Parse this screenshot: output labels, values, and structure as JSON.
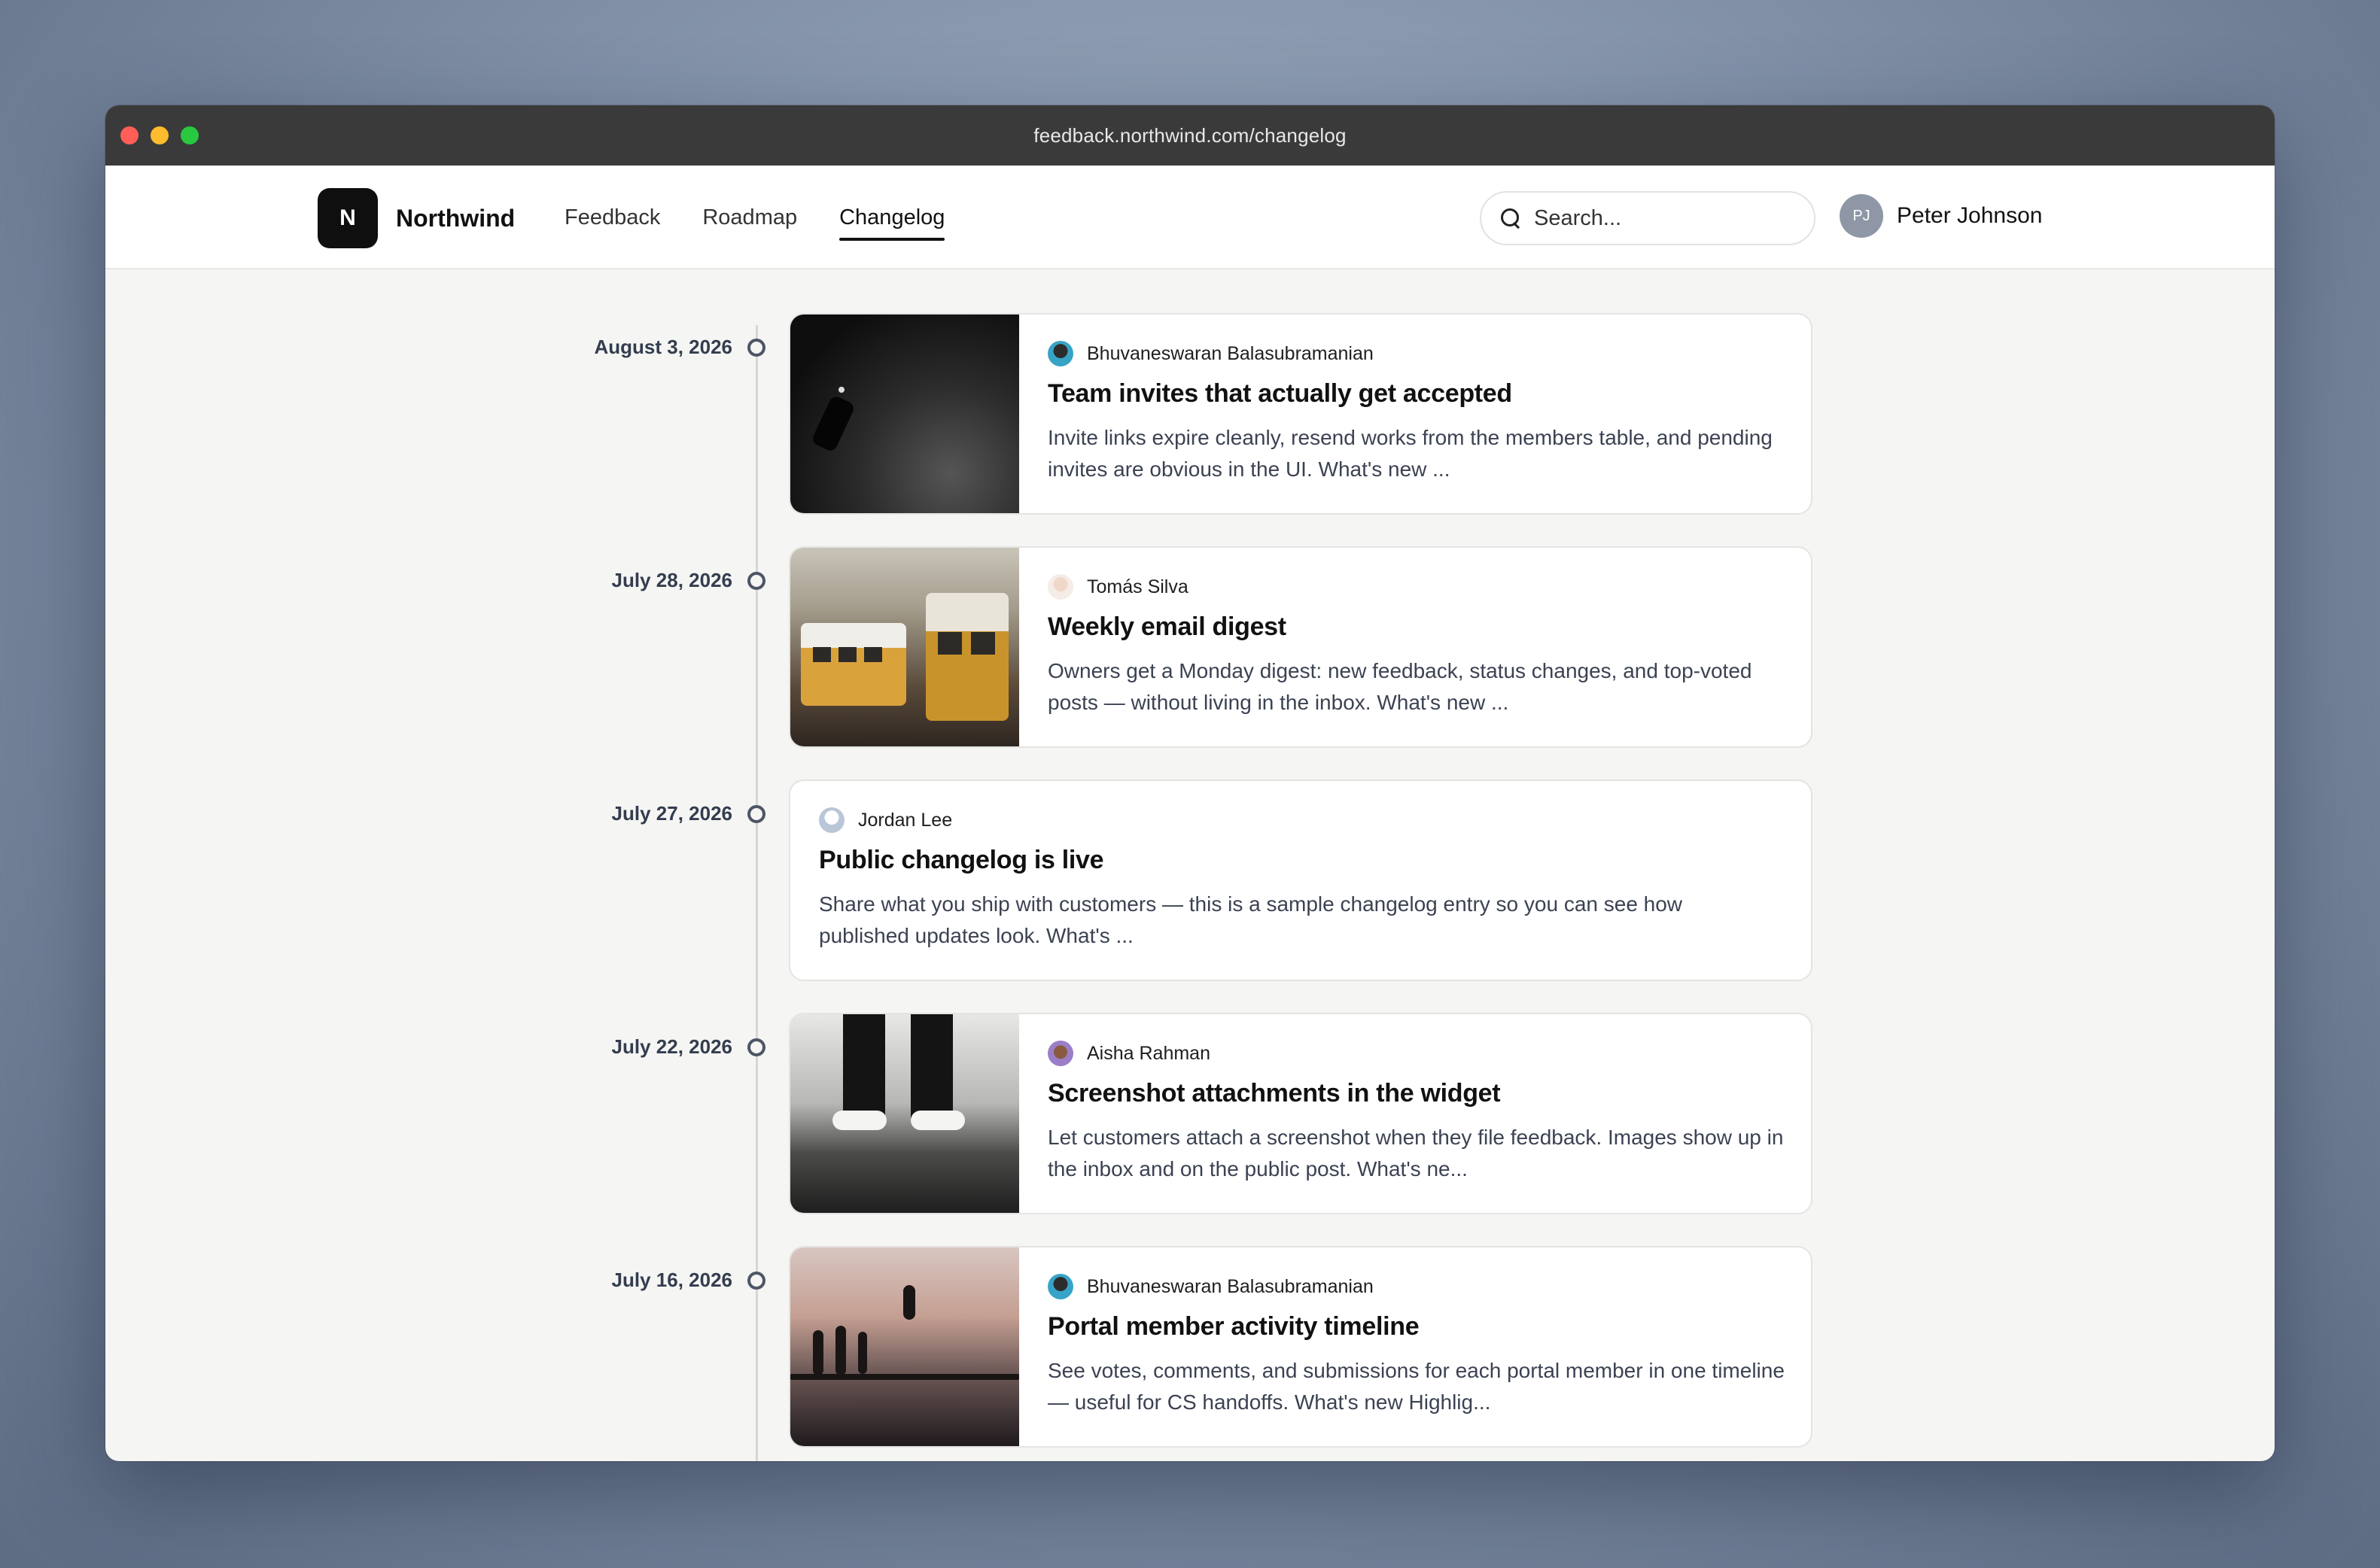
{
  "browser": {
    "url": "feedback.northwind.com/changelog"
  },
  "brand": {
    "logo_letter": "N",
    "name": "Northwind"
  },
  "nav": {
    "items": [
      {
        "label": "Feedback"
      },
      {
        "label": "Roadmap"
      },
      {
        "label": "Changelog",
        "active": true
      }
    ]
  },
  "search": {
    "placeholder": "Search..."
  },
  "user": {
    "initials": "PJ",
    "name": "Peter Johnson"
  },
  "entries": [
    {
      "date": "August 3, 2026",
      "author": "Bhuvaneswaran Balasubramanian",
      "title": "Team invites that actually get accepted",
      "excerpt": "Invite links expire cleanly, resend works from the members table, and pending invites are obvious in the UI. What's new ...",
      "has_image": true
    },
    {
      "date": "July 28, 2026",
      "author": "Tomás Silva",
      "title": "Weekly email digest",
      "excerpt": "Owners get a Monday digest: new feedback, status changes, and top-voted posts — without living in the inbox. What's new ...",
      "has_image": true
    },
    {
      "date": "July 27, 2026",
      "author": "Jordan Lee",
      "title": "Public changelog is live",
      "excerpt": "Share what you ship with customers — this is a sample changelog entry so you can see how published updates look. What's ...",
      "has_image": false
    },
    {
      "date": "July 22, 2026",
      "author": "Aisha Rahman",
      "title": "Screenshot attachments in the widget",
      "excerpt": "Let customers attach a screenshot when they file feedback. Images show up in the inbox and on the public post. What's ne...",
      "has_image": true
    },
    {
      "date": "July 16, 2026",
      "author": "Bhuvaneswaran Balasubramanian",
      "title": "Portal member activity timeline",
      "excerpt": "See votes, comments, and submissions for each portal member in one timeline — useful for CS handoffs. What's new Highlig...",
      "has_image": true
    }
  ],
  "colors": {
    "accent": "#111111",
    "timeline_marker": "#4d5566"
  }
}
